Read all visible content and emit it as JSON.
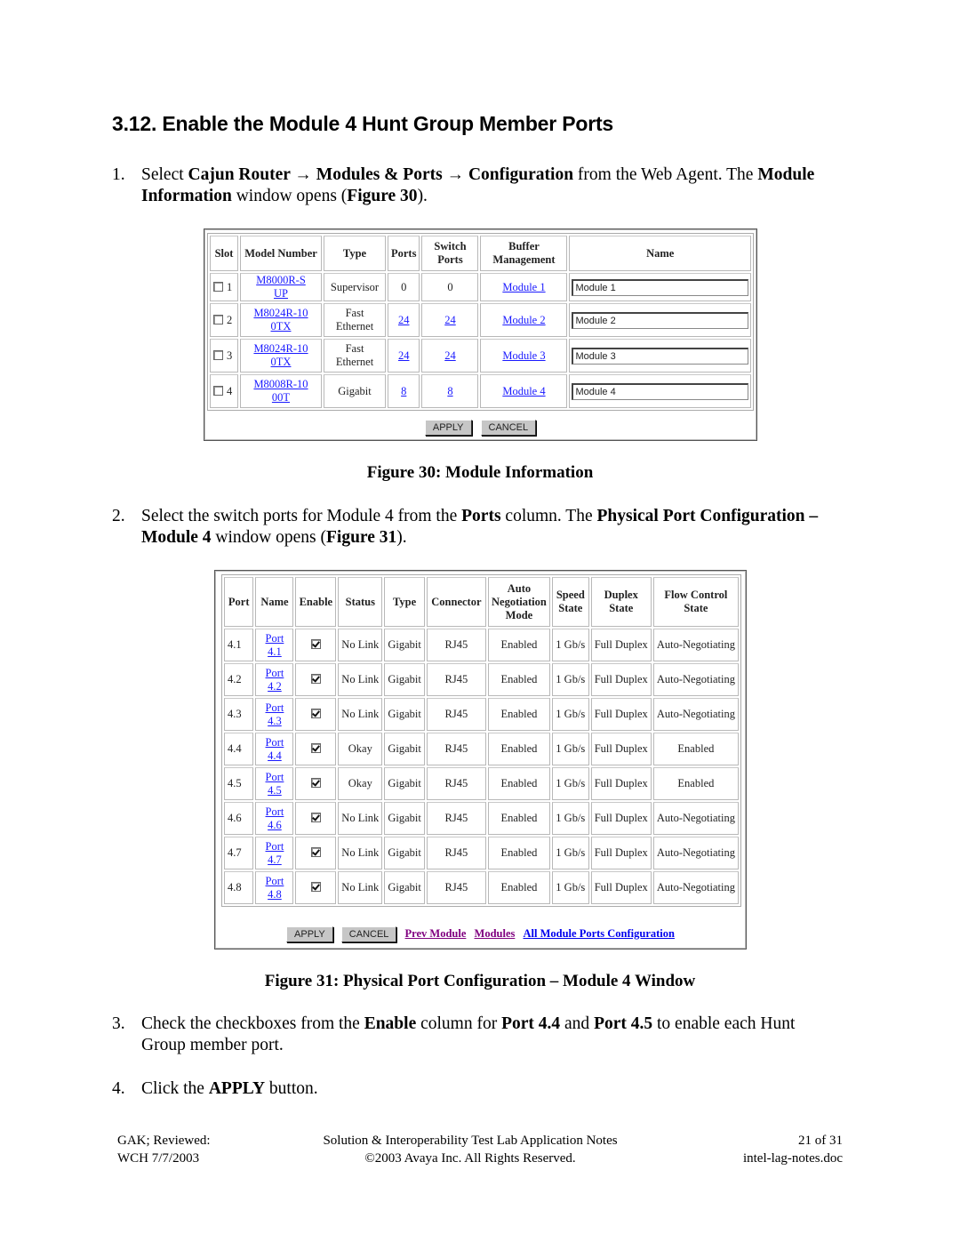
{
  "section": {
    "heading": "3.12. Enable the Module 4 Hunt Group Member Ports"
  },
  "steps": [
    {
      "num": "1.",
      "parts": [
        {
          "t": "Select ",
          "b": false
        },
        {
          "t": "Cajun Router → Modules & Ports → Configuration",
          "b": true
        },
        {
          "t": " from the Web Agent.  The ",
          "b": false
        },
        {
          "t": "Module Information",
          "b": true
        },
        {
          "t": " window opens (",
          "b": false
        },
        {
          "t": "Figure 30",
          "b": true
        },
        {
          "t": ").",
          "b": false
        }
      ]
    },
    {
      "num": "2.",
      "parts": [
        {
          "t": "Select the switch ports for Module 4 from the ",
          "b": false
        },
        {
          "t": "Ports",
          "b": true
        },
        {
          "t": " column.  The ",
          "b": false
        },
        {
          "t": "Physical Port Configuration – Module 4",
          "b": true
        },
        {
          "t": " window opens (",
          "b": false
        },
        {
          "t": "Figure 31",
          "b": true
        },
        {
          "t": ").",
          "b": false
        }
      ]
    },
    {
      "num": "3.",
      "parts": [
        {
          "t": "Check the checkboxes from the ",
          "b": false
        },
        {
          "t": "Enable",
          "b": true
        },
        {
          "t": " column for ",
          "b": false
        },
        {
          "t": "Port 4.4",
          "b": true
        },
        {
          "t": " and ",
          "b": false
        },
        {
          "t": "Port 4.5",
          "b": true
        },
        {
          "t": " to enable each Hunt Group member port.",
          "b": false
        }
      ]
    },
    {
      "num": "4.",
      "parts": [
        {
          "t": "Click the ",
          "b": false
        },
        {
          "t": "APPLY",
          "b": true
        },
        {
          "t": " button.",
          "b": false
        }
      ]
    }
  ],
  "figure30": {
    "caption": "Figure 30: Module Information",
    "headers": [
      "Slot",
      "Model Number",
      "Type",
      "Ports",
      "Switch Ports",
      "Buffer Management",
      "Name"
    ],
    "rows": [
      {
        "slot": "1",
        "checked": false,
        "model": "M8000R-SUP",
        "type": "Supervisor",
        "ports": "0",
        "ports_link": false,
        "switch_ports": "0",
        "buffer": "Module 1",
        "name": "Module 1"
      },
      {
        "slot": "2",
        "checked": false,
        "model": "M8024R-100TX",
        "type": "Fast Ethernet",
        "ports": "24",
        "ports_link": true,
        "switch_ports": "24",
        "buffer": "Module 2",
        "name": "Module 2"
      },
      {
        "slot": "3",
        "checked": false,
        "model": "M8024R-100TX",
        "type": "Fast Ethernet",
        "ports": "24",
        "ports_link": true,
        "switch_ports": "24",
        "buffer": "Module 3",
        "name": "Module 3"
      },
      {
        "slot": "4",
        "checked": false,
        "model": "M8008R-1000T",
        "type": "Gigabit",
        "ports": "8",
        "ports_link": true,
        "switch_ports": "8",
        "buffer": "Module 4",
        "name": "Module 4"
      }
    ],
    "apply_label": "APPLY",
    "cancel_label": "CANCEL"
  },
  "figure31": {
    "caption": "Figure 31: Physical Port Configuration – Module 4 Window",
    "headers": [
      "Port",
      "Name",
      "Enable",
      "Status",
      "Type",
      "Connector",
      "Auto Negotiation Mode",
      "Speed State",
      "Duplex State",
      "Flow Control State"
    ],
    "rows": [
      {
        "port": "4.1",
        "name": "Port 4.1",
        "enabled": true,
        "status": "No Link",
        "type": "Gigabit",
        "connector": "RJ45",
        "autoneg": "Enabled",
        "speed": "1 Gb/s",
        "duplex": "Full Duplex",
        "flow": "Auto-Negotiating"
      },
      {
        "port": "4.2",
        "name": "Port 4.2",
        "enabled": true,
        "status": "No Link",
        "type": "Gigabit",
        "connector": "RJ45",
        "autoneg": "Enabled",
        "speed": "1 Gb/s",
        "duplex": "Full Duplex",
        "flow": "Auto-Negotiating"
      },
      {
        "port": "4.3",
        "name": "Port 4.3",
        "enabled": true,
        "status": "No Link",
        "type": "Gigabit",
        "connector": "RJ45",
        "autoneg": "Enabled",
        "speed": "1 Gb/s",
        "duplex": "Full Duplex",
        "flow": "Auto-Negotiating"
      },
      {
        "port": "4.4",
        "name": "Port 4.4",
        "enabled": true,
        "status": "Okay",
        "type": "Gigabit",
        "connector": "RJ45",
        "autoneg": "Enabled",
        "speed": "1 Gb/s",
        "duplex": "Full Duplex",
        "flow": "Enabled"
      },
      {
        "port": "4.5",
        "name": "Port 4.5",
        "enabled": true,
        "status": "Okay",
        "type": "Gigabit",
        "connector": "RJ45",
        "autoneg": "Enabled",
        "speed": "1 Gb/s",
        "duplex": "Full Duplex",
        "flow": "Enabled"
      },
      {
        "port": "4.6",
        "name": "Port 4.6",
        "enabled": true,
        "status": "No Link",
        "type": "Gigabit",
        "connector": "RJ45",
        "autoneg": "Enabled",
        "speed": "1 Gb/s",
        "duplex": "Full Duplex",
        "flow": "Auto-Negotiating"
      },
      {
        "port": "4.7",
        "name": "Port 4.7",
        "enabled": true,
        "status": "No Link",
        "type": "Gigabit",
        "connector": "RJ45",
        "autoneg": "Enabled",
        "speed": "1 Gb/s",
        "duplex": "Full Duplex",
        "flow": "Auto-Negotiating"
      },
      {
        "port": "4.8",
        "name": "Port 4.8",
        "enabled": true,
        "status": "No Link",
        "type": "Gigabit",
        "connector": "RJ45",
        "autoneg": "Enabled",
        "speed": "1 Gb/s",
        "duplex": "Full Duplex",
        "flow": "Auto-Negotiating"
      }
    ],
    "apply_label": "APPLY",
    "cancel_label": "CANCEL",
    "links": {
      "prev_module": "Prev Module",
      "modules": "Modules",
      "all_ports": "All Module Ports Configuration"
    }
  },
  "footer": {
    "left1": "GAK; Reviewed:",
    "left2": "WCH 7/7/2003",
    "center1": "Solution & Interoperability Test Lab Application Notes",
    "center2": "©2003 Avaya Inc. All Rights Reserved.",
    "right1": "21 of 31",
    "right2": "intel-lag-notes.doc"
  },
  "colors": {
    "link": "#1a1aff",
    "visited_link": "#800080",
    "button_face": "#c6c6c6"
  }
}
